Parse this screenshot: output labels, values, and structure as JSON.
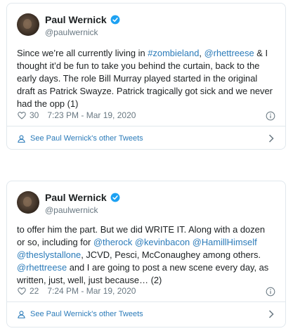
{
  "tweets": [
    {
      "author": {
        "name": "Paul Wernick",
        "handle": "@paulwernick"
      },
      "lines": [
        [
          {
            "t": "Since we’re all currently living in "
          },
          {
            "t": "#zombieland",
            "link": true
          },
          {
            "t": ", "
          },
          {
            "t": "@rhettreese",
            "link": true
          },
          {
            "t": " & I"
          }
        ],
        [
          {
            "t": "thought it’d be fun to take you behind the curtain, back to the"
          }
        ],
        [
          {
            "t": "early days.  The role Bill Murray played started in the original"
          }
        ],
        [
          {
            "t": "draft as Patrick Swayze.  Patrick tragically got sick and we never"
          }
        ],
        [
          {
            "t": "had the opp (1)"
          }
        ]
      ],
      "likes": "30",
      "timestamp": "7:23 PM - Mar 19, 2020",
      "more_label": "See Paul Wernick's other Tweets"
    },
    {
      "author": {
        "name": "Paul Wernick",
        "handle": "@paulwernick"
      },
      "lines": [
        [
          {
            "t": "to offer him the part.  But we did WRITE IT.  Along with a dozen"
          }
        ],
        [
          {
            "t": "or so, including for "
          },
          {
            "t": "@therock",
            "link": true
          },
          {
            "t": " "
          },
          {
            "t": "@kevinbacon",
            "link": true
          },
          {
            "t": " "
          },
          {
            "t": "@HamillHimself",
            "link": true
          }
        ],
        [
          {
            "t": "@theslystallone",
            "link": true
          },
          {
            "t": ", JCVD, Pesci, McConaughey among others."
          }
        ],
        [
          {
            "t": "@rhettreese",
            "link": true
          },
          {
            "t": " and I are going to post a new scene every day, as"
          }
        ],
        [
          {
            "t": "written, just, well, just because… (2)"
          }
        ]
      ],
      "likes": "22",
      "timestamp": "7:24 PM - Mar 19, 2020",
      "more_label": "See Paul Wernick's other Tweets"
    }
  ],
  "colors": {
    "link": "#2b7bb9",
    "verified": "#1da1f2",
    "meta": "#697882",
    "border": "#e1e8ed"
  },
  "icons": [
    "avatar",
    "verified-badge-icon",
    "heart-icon",
    "info-icon",
    "user-icon",
    "chevron-right-icon"
  ]
}
